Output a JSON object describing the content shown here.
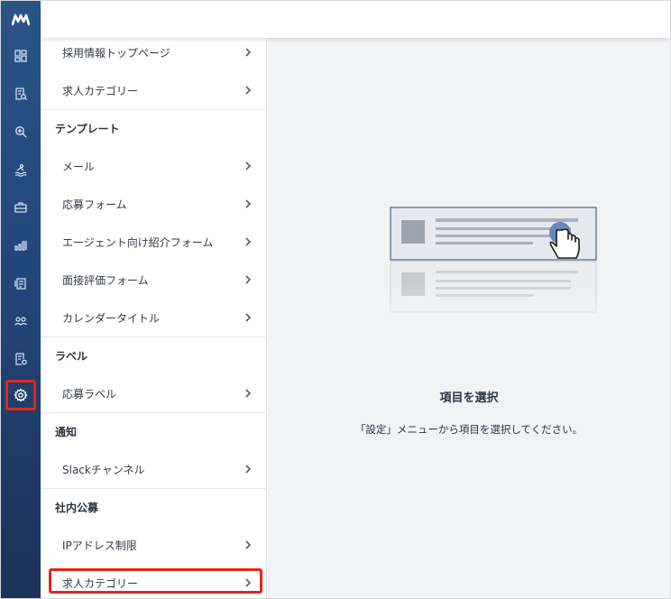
{
  "rail": {
    "logo": "logo-icon",
    "items": [
      "dashboard-icon",
      "document-search-icon",
      "magnifier-icon",
      "swimmer-icon",
      "briefcase-icon",
      "bar-chart-icon",
      "documents-icon",
      "users-icon",
      "form-icon",
      "gear-icon"
    ]
  },
  "menu": {
    "item_1": "採用情報トップページ",
    "item_2": "求人カテゴリー",
    "section_template": "テンプレート",
    "item_mail": "メール",
    "item_form": "応募フォーム",
    "item_agent_form": "エージェント向け紹介フォーム",
    "item_interview": "面接評価フォーム",
    "item_calendar": "カレンダータイトル",
    "section_label": "ラベル",
    "item_label": "応募ラベル",
    "section_notify": "通知",
    "item_slack": "Slackチャンネル",
    "section_internal": "社内公募",
    "item_ip": "IPアドレス制限",
    "item_category": "求人カテゴリー"
  },
  "main": {
    "title": "項目を選択",
    "description": "「設定」メニューから項目を選択してください。"
  },
  "colors": {
    "rail_top": "#2a5486",
    "rail_bottom": "#1b3358",
    "accent": "#6a86c0",
    "highlight": "#e8231e"
  }
}
